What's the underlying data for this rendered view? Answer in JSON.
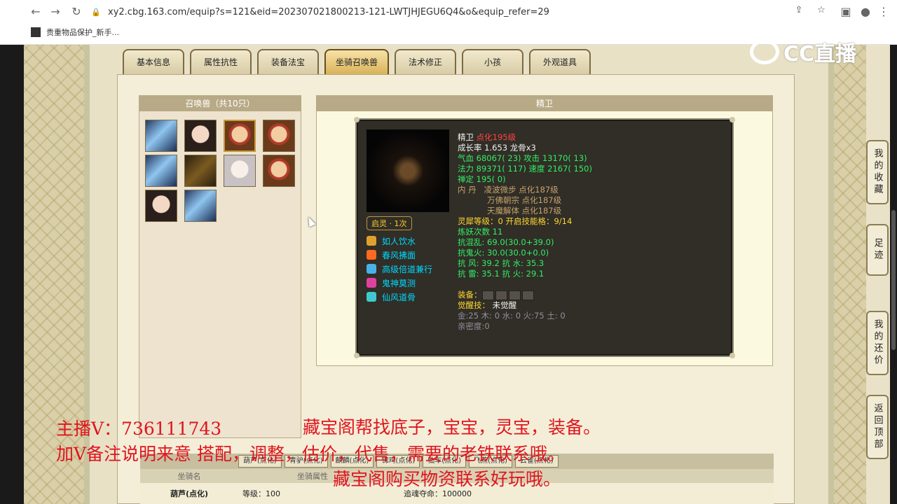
{
  "browser": {
    "url": "xy2.cbg.163.com/equip?s=121&eid=202307021800213-121-LWTJHJEGU6Q4&o&equip_refer=29",
    "bookmark": "贵重物品保护_新手..."
  },
  "tabs": [
    "基本信息",
    "属性抗性",
    "装备法宝",
    "坐骑召唤兽",
    "法术修正",
    "小孩",
    "外观道具"
  ],
  "active_tab": "坐骑召唤兽",
  "pet_panel": {
    "title": "召唤兽（共10只）"
  },
  "detail": {
    "title": "精卫",
    "qiling": "启灵 · 1次",
    "skills": [
      "如人饮水",
      "春风拂面",
      "高级倍道兼行",
      "鬼神莫测",
      "仙风道骨"
    ],
    "info": {
      "name": "精卫",
      "level": "点化195级",
      "growth": "成长率 1.653 龙骨x3",
      "hp": "气血 68067( 23)",
      "atk": "攻击 13170( 13)",
      "mp": "法力 89371( 117)",
      "spd": "速度 2167( 150)",
      "focus": "禅定 195( 0)",
      "neidan_label": "内 丹",
      "neidan": [
        "凌波微步 点化187级",
        "万佛朝宗 点化187级",
        "天魔解体 点化187级"
      ],
      "linxi": "灵犀等级：0 开启技能格：9/14",
      "lianyao": "炼妖次数 11",
      "res1": "抗混乱: 69.0(30.0+39.0)",
      "res2": "抗鬼火: 30.0(30.0+0.0)",
      "res3": "抗  风: 39.2 抗  水: 35.3",
      "res4": "抗  雷: 35.1 抗  火: 29.1",
      "equip_label": "装备：",
      "awaken_label": "觉醒技：",
      "awaken_value": "未觉醒",
      "elements": "金:25 木: 0 水: 0 火:75 土: 0",
      "intimacy": "亲密度:0"
    }
  },
  "side_buttons": [
    "我的收藏",
    "足迹",
    "我的还价",
    "返回顶部"
  ],
  "logo": "CC直播",
  "bottom": {
    "tabs": [
      "葫芦(点化)",
      "青驴(点化)",
      "麒麟(点化)",
      "锦鸡(点化)",
      "仙车(点化)",
      "飞燕(点化)",
      "云雀(点化)"
    ],
    "col_name": "坐骑名",
    "col_attr": "坐骑属性",
    "row_name": "葫芦(点化)",
    "row_level": "等级：100",
    "row_life": "追魂夺命：100000"
  },
  "overlay": {
    "line1a": "主播V：736111743",
    "line1b": "藏宝阁帮找底子，宝宝，灵宝，装备。",
    "line2": "加V备注说明来意    搭配，调整，估价，代售，需要的老铁联系哦。",
    "line3": "藏宝阁购买物资联系好玩哦。"
  },
  "colors": {
    "overlay": "#e0141e",
    "card_bg": "#302e26",
    "skill_text": "#00d8ff"
  }
}
